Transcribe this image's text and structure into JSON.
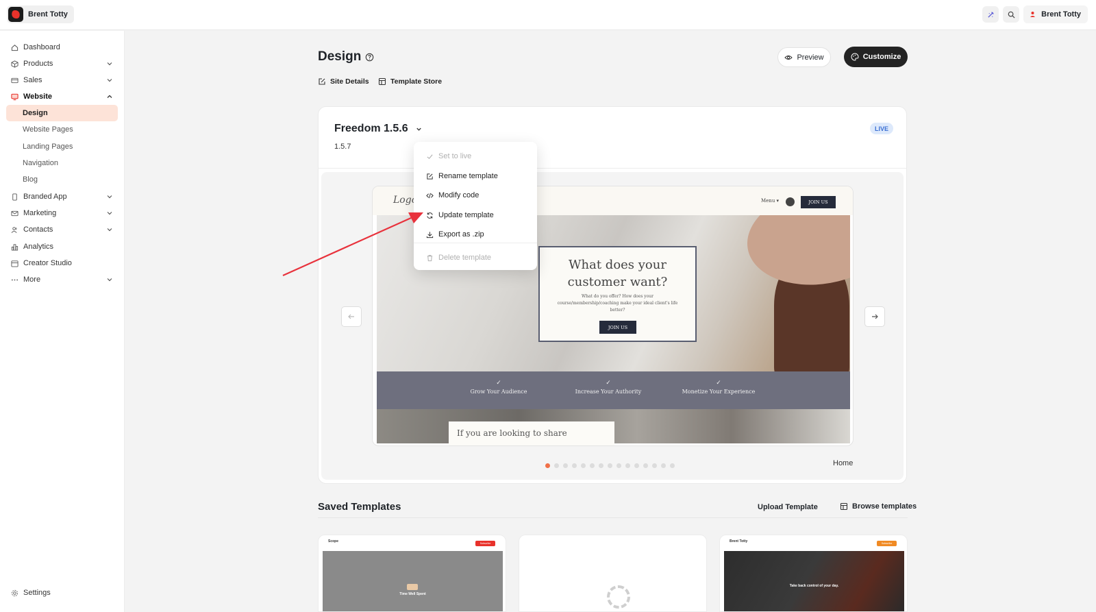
{
  "header": {
    "brand_name": "Brent Totty",
    "user_name": "Brent Totty",
    "icons": [
      "sparkle-icon",
      "search-icon",
      "user-icon"
    ]
  },
  "sidebar": {
    "items": [
      {
        "label": "Dashboard",
        "icon": "home-icon"
      },
      {
        "label": "Products",
        "icon": "box-icon",
        "expandable": true
      },
      {
        "label": "Sales",
        "icon": "credit-card-icon",
        "expandable": true
      },
      {
        "label": "Website",
        "icon": "monitor-icon",
        "expanded": true,
        "accent": "#e8322b"
      },
      {
        "label": "Branded App",
        "icon": "phone-icon",
        "expandable": true
      },
      {
        "label": "Marketing",
        "icon": "mail-icon",
        "expandable": true
      },
      {
        "label": "Contacts",
        "icon": "users-icon",
        "expandable": true
      },
      {
        "label": "Analytics",
        "icon": "bar-chart-icon"
      },
      {
        "label": "Creator Studio",
        "icon": "calendar-icon"
      },
      {
        "label": "More",
        "icon": "dots-icon",
        "expandable": true
      }
    ],
    "website_subitems": [
      "Design",
      "Website Pages",
      "Landing Pages",
      "Navigation",
      "Blog"
    ],
    "active_subitem": "Design",
    "settings_label": "Settings"
  },
  "main": {
    "title": "Design",
    "tabs": [
      "Site Details",
      "Template Store"
    ],
    "preview_label": "Preview",
    "customize_label": "Customize",
    "template": {
      "name": "Freedom 1.5.6",
      "version": "1.5.7",
      "status": "LIVE"
    },
    "site_preview": {
      "logo": "Logo",
      "menu": "Menu",
      "join_button": "JOIN US",
      "hero_title": "What does your customer want?",
      "hero_text": "What do you offer? How does your course/membership/coaching make your ideal client's life better?",
      "hero_button": "JOIN US",
      "features": [
        "Grow Your Audience",
        "Increase Your Authority",
        "Monetize Your Experience"
      ],
      "bottom_text": "If you are looking to share"
    },
    "carousel": {
      "total_pages": 15,
      "current_index": 0,
      "page_label": "Home"
    },
    "dropdown_menu": {
      "items": [
        {
          "label": "Set to live",
          "icon": "check-icon",
          "disabled": true
        },
        {
          "label": "Rename template",
          "icon": "edit-icon",
          "disabled": false
        },
        {
          "label": "Modify code",
          "icon": "code-icon",
          "disabled": false
        },
        {
          "label": "Update template",
          "icon": "refresh-icon",
          "disabled": false
        },
        {
          "label": "Export as .zip",
          "icon": "download-icon",
          "disabled": false
        },
        {
          "label": "Delete template",
          "icon": "trash-icon",
          "disabled": true
        }
      ]
    }
  },
  "saved_templates": {
    "title": "Saved Templates",
    "upload_label": "Upload Template",
    "browse_label": "Browse templates",
    "cards": [
      {
        "name": "Scope",
        "button": "Subscribe",
        "caption": "Time Well Spent",
        "accent": "#e8322b"
      },
      {
        "name": "",
        "loading": true
      },
      {
        "name": "Brent Totty",
        "button": "Subscribe",
        "caption": "Take back control of your day.",
        "accent": "#f08a24"
      }
    ]
  },
  "colors": {
    "accent": "#e8322b",
    "active_bg": "#fde3d8",
    "customize_bg": "#232323",
    "live_badge": "#3b6fd3",
    "annotation_arrow": "#e8323c"
  }
}
